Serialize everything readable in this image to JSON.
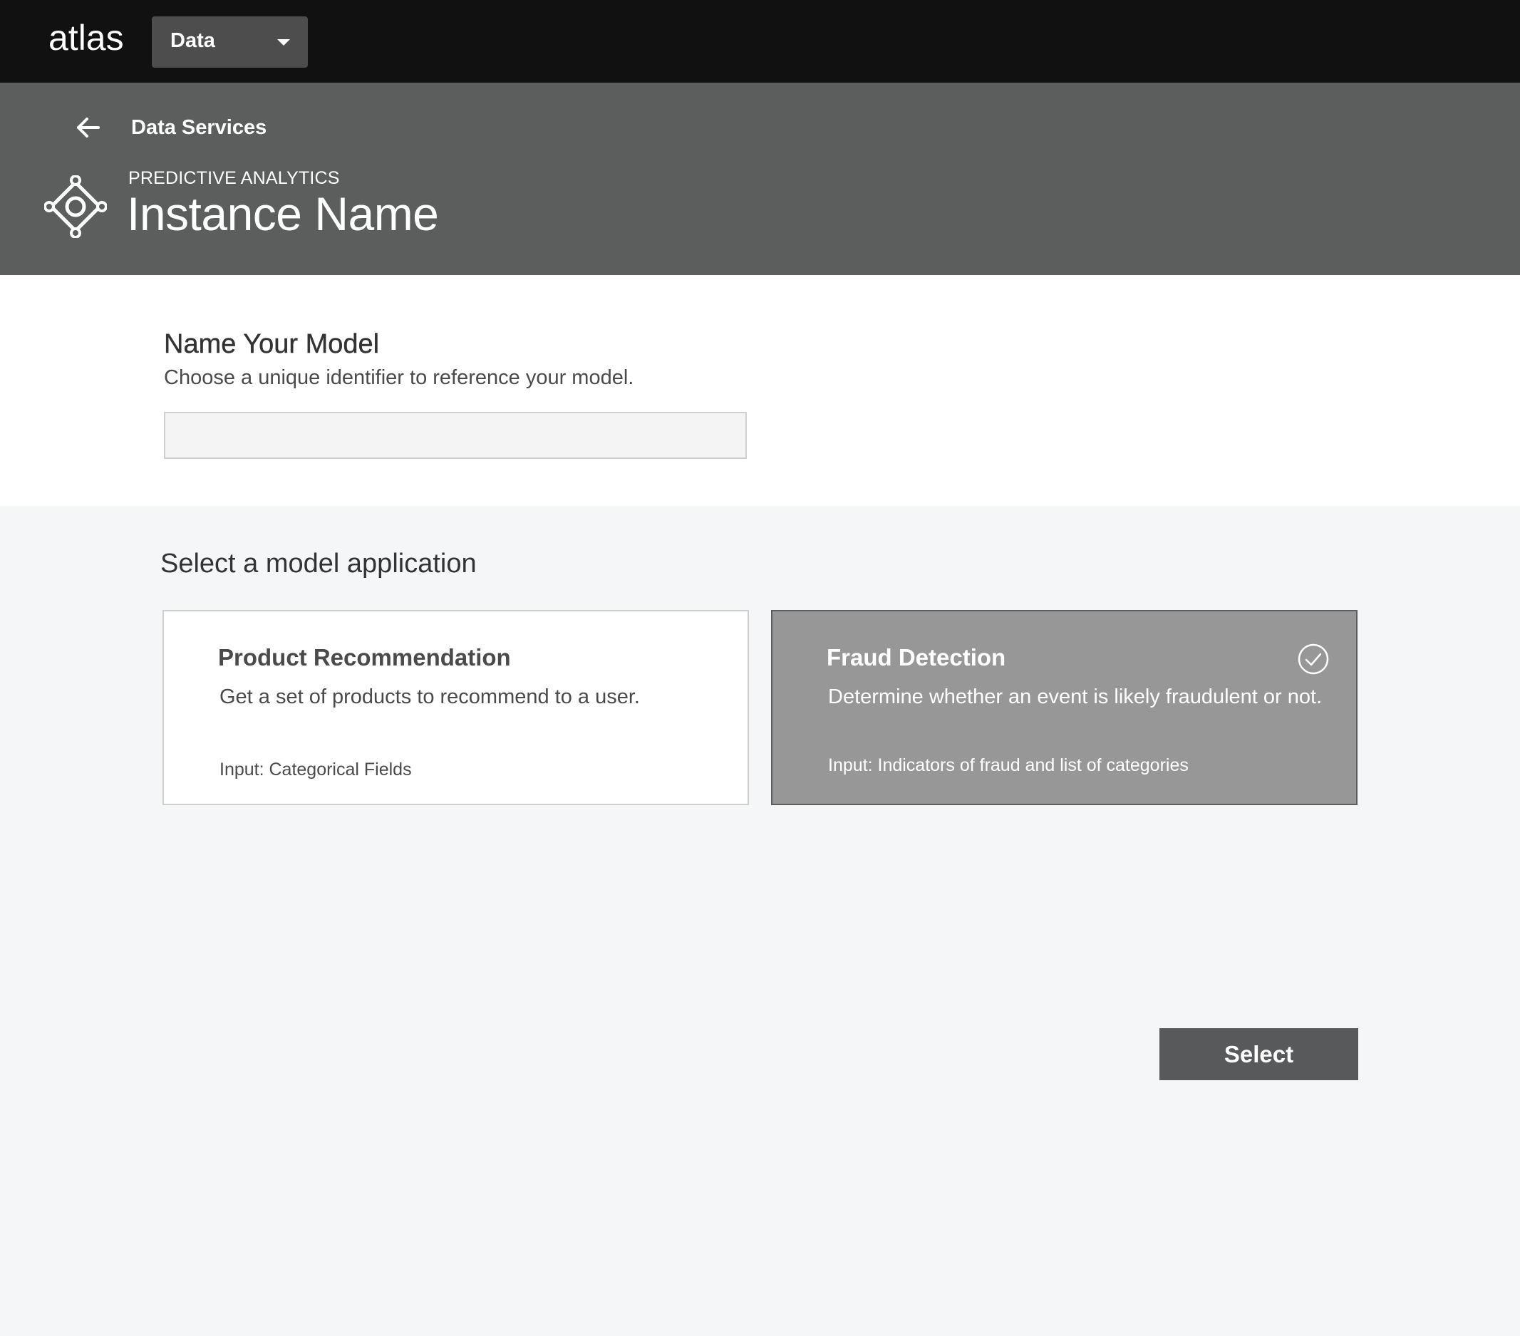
{
  "topbar": {
    "logo": "atlas",
    "dropdown": {
      "selected": "Data"
    }
  },
  "header": {
    "back_label": "Data Services",
    "kicker": "PREDICTIVE ANALYTICS",
    "title": "Instance Name"
  },
  "name_section": {
    "title": "Name Your Model",
    "description": "Choose a unique identifier to reference your model.",
    "input_value": "",
    "input_placeholder": ""
  },
  "applications": {
    "title": "Select a model application",
    "cards": [
      {
        "title": "Product Recommendation",
        "description": "Get a set of products to recommend to a user.",
        "input": "Input: Categorical Fields",
        "selected": false
      },
      {
        "title": "Fraud Detection",
        "description": "Determine whether an event is likely fraudulent or not.",
        "input": "Input: Indicators of fraud and list of categories",
        "selected": true
      }
    ]
  },
  "actions": {
    "select_label": "Select"
  },
  "icons": {
    "back": "arrow-left-icon",
    "service": "predictive-analytics-icon",
    "dropdown": "chevron-down-icon",
    "selected": "checkmark-circle-icon"
  },
  "colors": {
    "topbar": "#111111",
    "header": "#5c5e5d",
    "page_background": "#f5f6f8",
    "selected_card": "#979797",
    "button": "#58595b"
  }
}
